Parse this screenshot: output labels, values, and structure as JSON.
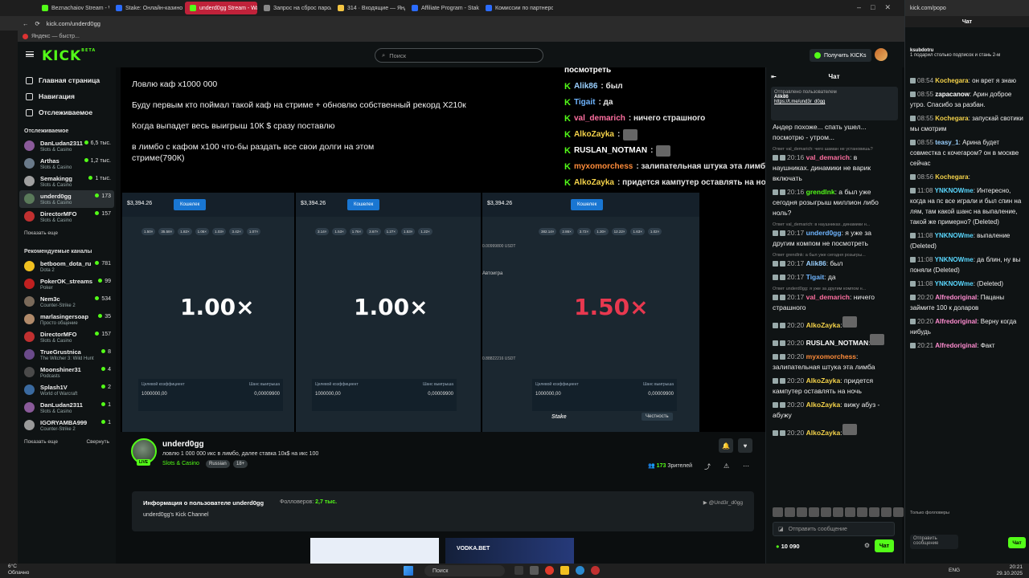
{
  "browser": {
    "tabs": [
      {
        "label": "Beznachaiov Stream - Wa",
        "color": "#53fc18",
        "active": false
      },
      {
        "label": "Stake: Онлайн-казино и",
        "color": "#2b6cff",
        "active": false
      },
      {
        "label": "underd0gg Stream - Wat",
        "color": "#53fc18",
        "active": true
      },
      {
        "label": "Запрос на сброс пароля",
        "color": "#888888",
        "active": false
      },
      {
        "label": "314 · Входящие — Яндек",
        "color": "#f4c542",
        "active": false
      },
      {
        "label": "Affiliate Program - Stake",
        "color": "#2b6cff",
        "active": false
      },
      {
        "label": "Комиссии по партнерско",
        "color": "#2b6cff",
        "active": false
      }
    ],
    "url": "kick.com/underd0gg",
    "bookmark": "Яндекс — быстр..."
  },
  "header": {
    "logo": "KICK",
    "logo_beta": "BETA",
    "search_placeholder": "Поиск",
    "get_kicks": "Получить KICKs"
  },
  "sidebar": {
    "nav": [
      {
        "label": "Главная страница"
      },
      {
        "label": "Навигация"
      },
      {
        "label": "Отслеживаемое"
      }
    ],
    "following_title": "Отслеживаемое",
    "following": [
      {
        "name": "DanLudan2311",
        "category": "Slots & Casino",
        "viewers": "6,5 тыс.",
        "color": "#8a5a9a"
      },
      {
        "name": "Arthas",
        "category": "Slots & Casino",
        "viewers": "1,2 тыс.",
        "color": "#6a7a8a"
      },
      {
        "name": "Semakingg",
        "category": "Slots & Casino",
        "viewers": "1 тыс.",
        "color": "#a0a0a0"
      },
      {
        "name": "underd0gg",
        "category": "Slots & Casino",
        "viewers": "173",
        "color": "#5a7a5a"
      },
      {
        "name": "DirectorMFO",
        "category": "Slots & Casino",
        "viewers": "157",
        "color": "#c03030"
      }
    ],
    "show_more": "Показать еще",
    "recommended_title": "Рекомендуемые каналы",
    "recommended": [
      {
        "name": "betboom_dota_ru",
        "category": "Dota 2",
        "viewers": "781",
        "color": "#f0c020"
      },
      {
        "name": "PokerOK_streams",
        "category": "Poker",
        "viewers": "99",
        "color": "#c02020"
      },
      {
        "name": "Nem3c",
        "category": "Counter-Strike 2",
        "viewers": "534",
        "color": "#7a6a5a"
      },
      {
        "name": "marlasingersoap",
        "category": "Просто общение",
        "viewers": "35",
        "color": "#b08a6a"
      },
      {
        "name": "DirectorMFO",
        "category": "Slots & Casino",
        "viewers": "157",
        "color": "#c03030"
      },
      {
        "name": "TrueGrustnica",
        "category": "The Witcher 3: Wild Hunt",
        "viewers": "8",
        "color": "#6a4a8a"
      },
      {
        "name": "Moonshiner31",
        "category": "Podcasts",
        "viewers": "4",
        "color": "#4a4a4a"
      },
      {
        "name": "Splash1V",
        "category": "World of Warcraft",
        "viewers": "2",
        "color": "#3a6aa0"
      },
      {
        "name": "DanLudan2311",
        "category": "Slots & Casino",
        "viewers": "1",
        "color": "#8a5a9a"
      },
      {
        "name": "IGORYAMBA999",
        "category": "Counter-Strike 2",
        "viewers": "1",
        "color": "#9a9a9a"
      }
    ],
    "show_more2": "Показать еще",
    "collapse": "Свернуть"
  },
  "video": {
    "lines": [
      "Ловлю каф х1000 000",
      "Буду первым кто поймал такой каф на стриме + обновлю собственный рекорд Х210к",
      "Когда выпадет весь выигрыш 10К $ сразу поставлю",
      "в лимбо с кафом х100 что-бы раздать все свои долги на этом",
      "стриме(790К)"
    ],
    "overlay_chat": [
      {
        "name": "посмотреть",
        "text": "",
        "color": "#ffffff"
      },
      {
        "name": "Alik86",
        "text": ": был",
        "color": "#9ad0ff"
      },
      {
        "name": "Tigait",
        "text": ": да",
        "color": "#6fb5ff"
      },
      {
        "name": "val_demarich",
        "text": ": ничего страшного",
        "color": "#ff6fa0"
      },
      {
        "name": "AlkoZayka",
        "text": ":",
        "color": "#f5d34a"
      },
      {
        "name": "RUSLAN_NOTMAN",
        "text": ":",
        "color": "#ffffff"
      },
      {
        "name": "myxomorchess",
        "text": ": залипательная штука эта лимба",
        "color": "#ff8c3a"
      },
      {
        "name": "AlkoZayka",
        "text": ": придется кампутер оставлять на но",
        "color": "#f5d34a"
      },
      {
        "name": "AlkoZayka",
        "text": ": вижу абуз - абужу",
        "color": "#f5d34a"
      }
    ],
    "panels": [
      {
        "balance": "$3,394.26",
        "wallet": "Кошелек",
        "multiplier": "1.00×",
        "mult_color": "#ffffff",
        "chips": [
          "1.50×",
          "35.58×",
          "1.82×",
          "1.06×",
          "1.03×",
          "3.42×",
          "1.07×"
        ],
        "field1": "Целевой коэффициент",
        "field2": "Шанс выигрыша",
        "val1": "1000000,00",
        "val2": "0,00009900"
      },
      {
        "balance": "$3,394.26",
        "wallet": "Кошелек",
        "multiplier": "1.00×",
        "mult_color": "#ffffff",
        "chips": [
          "3.14×",
          "1.53×",
          "1.76×",
          "3.67×",
          "1.27×",
          "1.53×",
          "1.22×"
        ],
        "field1": "Целевой коэффициент",
        "field2": "Шанс выигрыша",
        "val1": "1000000,00",
        "val2": "0,00009900"
      },
      {
        "balance": "$3,394.26",
        "wallet": "Кошелек",
        "multiplier": "1.50×",
        "mult_color": "#e8384f",
        "chips": [
          "382.14×",
          "2.86×",
          "3.72×",
          "1.30×",
          "12.22×",
          "1.63×",
          "1.02×"
        ],
        "field1": "Целевой коэффициент",
        "field2": "Шанс выигрыша",
        "val1": "1000000,00",
        "val2": "0,00009900"
      }
    ],
    "autoplay": "Автоигра",
    "usdt": "0.00999800 USDT",
    "usdt2": "0.88822216 USDT",
    "stake_logo": "Stake",
    "fairness": "Честность"
  },
  "channel": {
    "name": "underd0gg",
    "title": "ловлю 1 000 000 икс в лимбо, далее ставка 10к$ на икс 100",
    "category": "Slots & Casino",
    "tags": [
      "Russian",
      "18+"
    ],
    "live": "LIVE",
    "viewers": "173",
    "viewers_label": "Зрителей",
    "about_title": "Информация о пользователе underd0gg",
    "followers_label": "Фолловеров:",
    "followers": "2,7 тыс.",
    "description": "underd0gg's Kick Channel",
    "social": "@Und3r_d0gg",
    "banner2": "VODKA.BET"
  },
  "chat": {
    "title": "Чат",
    "pinned_by": "Отправлено пользователем",
    "pinned_user": "Alik86",
    "pinned_link": "https://t.me/und3r_d0gg",
    "messages": [
      {
        "reply": "",
        "time": "",
        "name": "",
        "text": "Андер похоже... спать ушел... посмотрю - утром...",
        "color": "#ffffff"
      },
      {
        "reply": "Ответ val_demarich: чего шаман не установишь?",
        "time": "20:16",
        "name": "val_demarich",
        "text": ": в наушниках. динамики не варик включать",
        "color": "#ff6fa0"
      },
      {
        "reply": "",
        "time": "20:16",
        "name": "grendlnk",
        "text": ": а был уже сегодня розыгрыш миллион либо ноль?",
        "color": "#53fc18"
      },
      {
        "reply": "Ответ val_demarich: в наушниках. динамики н...",
        "time": "20:17",
        "name": "underd0gg",
        "text": ": я уже за другим компом не посмотреть",
        "color": "#6fb5ff"
      },
      {
        "reply": "Ответ grendlnk: а был уже сегодня розыгры...",
        "time": "20:17",
        "name": "Alik86",
        "text": ": был",
        "color": "#9ad0ff"
      },
      {
        "reply": "",
        "time": "20:17",
        "name": "Tigait",
        "text": ": да",
        "color": "#6fb5ff"
      },
      {
        "reply": "Ответ underd0gg: я уже за другим компом н...",
        "time": "20:17",
        "name": "val_demarich",
        "text": ": ничего страшного",
        "color": "#ff6fa0"
      },
      {
        "reply": "",
        "time": "20:20",
        "name": "AlkoZayka",
        "text": ":",
        "color": "#f5d34a"
      },
      {
        "reply": "",
        "time": "20:20",
        "name": "RUSLAN_NOTMAN",
        "text": ":",
        "color": "#ffffff"
      },
      {
        "reply": "",
        "time": "20:20",
        "name": "myxomorchess",
        "text": ": залипательная штука эта лимба",
        "color": "#ff8c3a"
      },
      {
        "reply": "",
        "time": "20:20",
        "name": "AlkoZayka",
        "text": ": придется кампутер оставлять на ночь",
        "color": "#f5d34a"
      },
      {
        "reply": "",
        "time": "20:20",
        "name": "AlkoZayka",
        "text": ": вижу абуз - абужу",
        "color": "#f5d34a"
      },
      {
        "reply": "",
        "time": "20:20",
        "name": "AlkoZayka",
        "text": ":",
        "color": "#f5d34a"
      }
    ],
    "send_placeholder": "Отправить сообщение",
    "kicks": "10 090",
    "chat_button": "Чат"
  },
  "chat2": {
    "url": "kick.com/popo",
    "title": "Чат",
    "sub_user": "ksubdotru",
    "sub_text": "1 подарил столько подписок и стань 2-м",
    "messages": [
      {
        "time": "08:54",
        "name": "Kochegara",
        "text": ": он врет я знаю",
        "color": "#f5d34a"
      },
      {
        "time": "08:55",
        "name": "zapacanow",
        "text": ": Арин доброе утро. Спасибо за разбан.",
        "color": "#ffffff"
      },
      {
        "time": "08:55",
        "name": "Kochegara",
        "text": ": запускай свотики мы смотрим",
        "color": "#f5d34a"
      },
      {
        "time": "08:55",
        "name": "teasy_1",
        "text": ": Арина будет совместка с кочегаром? он в москве сейчас",
        "color": "#9ad0ff"
      },
      {
        "time": "08:56",
        "name": "Kochegara",
        "text": ":",
        "color": "#f5d34a"
      },
      {
        "time": "11:08",
        "name": "YNKNOWme",
        "text": ": Интересно, когда на пс все играли и был спин на лям, там какой шанс на выпаление, такой же примерно? (Deleted)",
        "color": "#5ad8ff"
      },
      {
        "time": "11:08",
        "name": "YNKNOWme",
        "text": ": выпаление (Deleted)",
        "color": "#5ad8ff"
      },
      {
        "time": "11:08",
        "name": "YNKNOWme",
        "text": ": да блин, ну вы поняли (Deleted)",
        "color": "#5ad8ff"
      },
      {
        "time": "11:08",
        "name": "YNKNOWme",
        "text": ": (Deleted)",
        "color": "#5ad8ff"
      },
      {
        "time": "20:20",
        "name": "Alfredoriginal",
        "text": ": Пацаны займите 100 к доларов",
        "color": "#ff8cd0"
      },
      {
        "time": "20:20",
        "name": "Alfredoriginal",
        "text": ": Верну когда нибудь",
        "color": "#ff8cd0"
      },
      {
        "time": "20:21",
        "name": "Alfredoriginal",
        "text": ": Факт",
        "color": "#ff8cd0"
      }
    ],
    "followers_only": "Только фолловеры",
    "send": "Отправить сообщение",
    "chat_button": "Чат"
  },
  "taskbar": {
    "temp": "6°C",
    "weather": "Облачно",
    "search": "Поиск",
    "lang": "ENG",
    "time": "20:21",
    "date": "29.10.2025"
  }
}
